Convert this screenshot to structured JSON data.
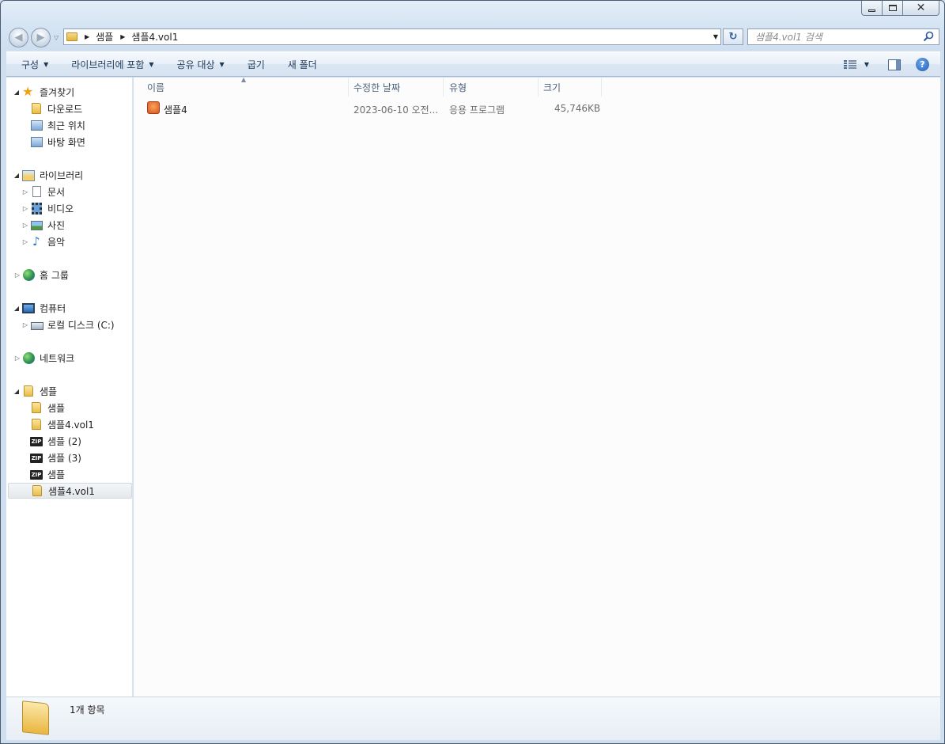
{
  "address": {
    "crumbs": [
      "샘플",
      "샘플4.vol1"
    ]
  },
  "search": {
    "placeholder": "샘플4.vol1 검색"
  },
  "toolbar": {
    "organize": "구성",
    "include_library": "라이브러리에 포함",
    "share_with": "공유 대상",
    "burn": "굽기",
    "new_folder": "새 폴더"
  },
  "navpane": {
    "favorites": {
      "label": "즐겨찾기",
      "items": [
        "다운로드",
        "최근 위치",
        "바탕 화면"
      ]
    },
    "libraries": {
      "label": "라이브러리",
      "items": [
        "문서",
        "비디오",
        "사진",
        "음악"
      ]
    },
    "homegroup": "홈 그룹",
    "computer": {
      "label": "컴퓨터",
      "items": [
        "로컬 디스크 (C:)"
      ]
    },
    "network": "네트워크",
    "sample_group": {
      "label": "샘플",
      "items": [
        {
          "label": "샘플",
          "icon": "folder-icon"
        },
        {
          "label": "샘플4.vol1",
          "icon": "folder-icon"
        },
        {
          "label": "샘플 (2)",
          "icon": "zip-icon"
        },
        {
          "label": "샘플 (3)",
          "icon": "zip-icon"
        },
        {
          "label": "샘플",
          "icon": "zip-icon"
        },
        {
          "label": "샘플4.vol1",
          "icon": "folder-icon",
          "selected": true
        }
      ]
    }
  },
  "filelist": {
    "columns": [
      "이름",
      "수정한 날짜",
      "유형",
      "크기"
    ],
    "rows": [
      {
        "name": "샘플4",
        "modified": "2023-06-10 오전...",
        "type": "응용 프로그램",
        "size": "45,746KB"
      }
    ]
  },
  "details": {
    "item_count": "1개 항목"
  }
}
